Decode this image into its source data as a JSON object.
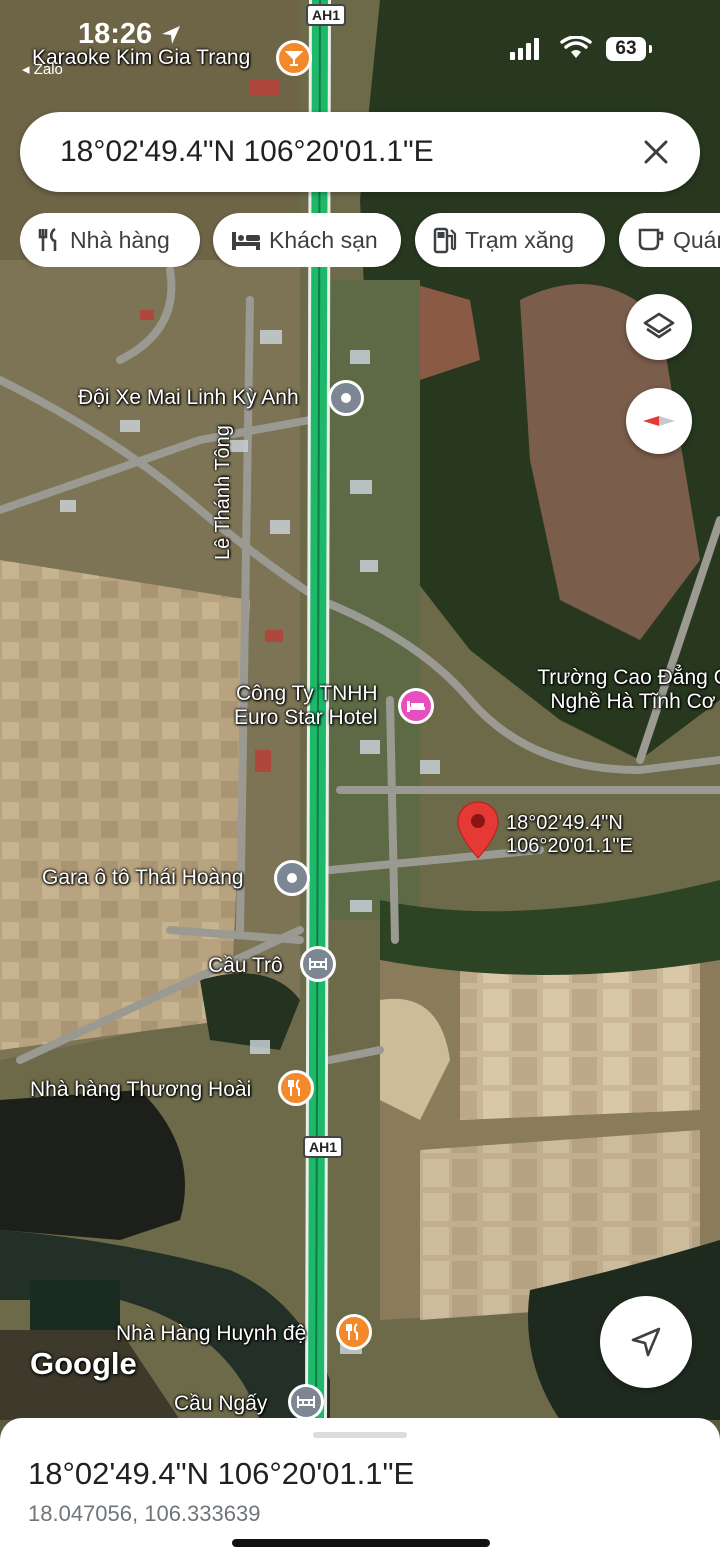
{
  "status_bar": {
    "time": "18:26",
    "back_app": "◂ Zalo",
    "battery": "63"
  },
  "search": {
    "query": "18°02'49.4\"N 106°20'01.1\"E"
  },
  "chips": [
    {
      "label": "Nhà hàng",
      "icon": "restaurant-icon"
    },
    {
      "label": "Khách sạn",
      "icon": "hotel-icon"
    },
    {
      "label": "Trạm xăng",
      "icon": "gas-station-icon"
    },
    {
      "label": "Quán",
      "icon": "coffee-icon"
    }
  ],
  "map": {
    "places": [
      {
        "name": "Karaoke Kim Gia Trang",
        "icon": "bar-icon"
      },
      {
        "name": "Đội Xe Mai Linh Kỳ Anh",
        "icon": "place-icon"
      },
      {
        "name": "Công Ty TNHH\nEuro Star Hotel",
        "icon": "hotel-icon"
      },
      {
        "name": "Trường Cao Đẳng C\nNghề Hà Tĩnh Cơ",
        "icon": ""
      },
      {
        "name": "Gara ô tô Thái Hoàng",
        "icon": "place-icon"
      },
      {
        "name": "Cầu Trô",
        "icon": "bridge-icon"
      },
      {
        "name": "Nhà hàng Thương Hoài",
        "icon": "restaurant-icon"
      },
      {
        "name": "Nhà Hàng Huynh đệ",
        "icon": "restaurant-icon"
      },
      {
        "name": "Cầu Ngấy",
        "icon": "bridge-icon"
      }
    ],
    "road_name": "Lê Thánh Tông",
    "highway_shield": "AH1",
    "dropped_pin": {
      "line1": "18°02'49.4\"N",
      "line2": "106°20'01.1\"E"
    },
    "attribution": "Google"
  },
  "bottom_sheet": {
    "title": "18°02'49.4\"N 106°20'01.1\"E",
    "decimal": "18.047056, 106.333639"
  },
  "colors": {
    "road_highway": "#1db86a",
    "pin_red": "#e53935",
    "poi_orange": "#f2892a",
    "poi_gray": "#7d8794",
    "poi_pink": "#e64fbd"
  }
}
